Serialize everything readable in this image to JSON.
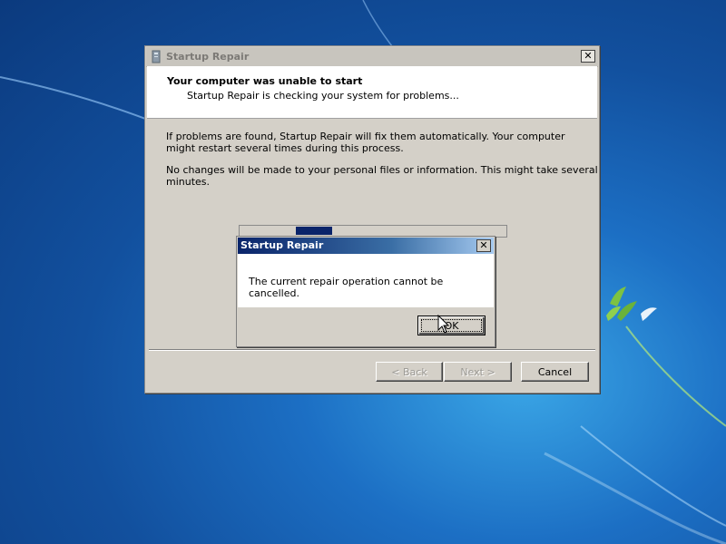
{
  "colors": {
    "desktop_dark": "#0b3a7e",
    "desktop_light": "#3aa6e6",
    "window_face": "#d4d0c8",
    "dialog_title_start": "#0a246a",
    "dialog_title_end": "#a6caf0",
    "progress_fill": "#0a246a"
  },
  "main_window": {
    "title": "Startup Repair",
    "title_icon": "startup-repair-icon",
    "close_label": "✕",
    "header": {
      "title": "Your computer was unable to start",
      "subtitle": "Startup Repair is checking your system for problems..."
    },
    "body": {
      "paragraph1": "If problems are found, Startup Repair will fix them automatically. Your computer might restart several times during this process.",
      "paragraph2": "No changes will be made to your personal files or information. This might take several minutes."
    },
    "progress": {
      "style": "marquee",
      "indeterminate": true
    },
    "buttons": {
      "back": "< Back",
      "next": "Next >",
      "cancel": "Cancel"
    }
  },
  "dialog": {
    "title": "Startup Repair",
    "close_label": "✕",
    "message": "The current repair operation cannot be cancelled.",
    "ok_label": "OK"
  },
  "cursor": {
    "icon": "arrow-cursor-icon"
  }
}
